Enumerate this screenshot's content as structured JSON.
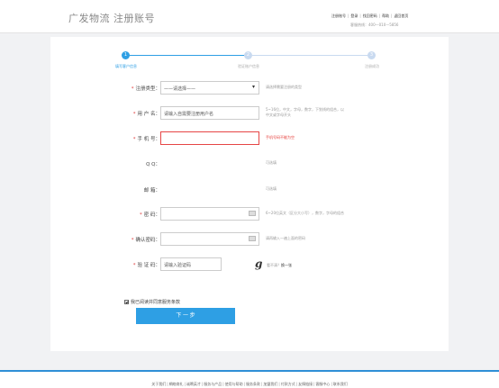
{
  "header": {
    "logo": "广发物流 注册账号",
    "links": [
      "注册账号",
      "登录",
      "找回密码",
      "帮助",
      "返回首页"
    ],
    "hotline": "客服热线：400—010—5856"
  },
  "steps": [
    {
      "num": "1",
      "label": "填写客户信息",
      "active": true
    },
    {
      "num": "2",
      "label": "验证账户信息",
      "active": false
    },
    {
      "num": "3",
      "label": "注册成功",
      "active": false
    }
  ],
  "form": {
    "type": {
      "label": "注册类型：",
      "value": "——请选择——",
      "hint": "请选择需要注册的类型"
    },
    "username": {
      "label": "用 户 名：",
      "placeholder": "请输入自需要注册用户名",
      "hint1": "5~16位，中文，字母，数字，下划线的组合，以",
      "hint2": "中文或字母开头"
    },
    "phone": {
      "label": "手 机 号：",
      "value": "",
      "hint": "手机号码不能为空"
    },
    "qq": {
      "label": "Q      Q：",
      "hint": "可选填"
    },
    "email": {
      "label": "邮      箱：",
      "hint": "可选填"
    },
    "password": {
      "label": "密      码：",
      "hint": "6~20位英文（区分大小写），数字，字母的组合"
    },
    "confirm": {
      "label": "确认密码：",
      "hint": "请再输入一遍上面的密码"
    },
    "captcha": {
      "label": "验 证 码：",
      "placeholder": "请输入验证码",
      "char": "g",
      "hint_prefix": "看不清？",
      "hint_link": "换一张"
    }
  },
  "agree_text": "我已阅读并同意服务条款",
  "next_button": "下 一 步",
  "footer": [
    "关于我们",
    "網絡商礼",
    "诚聘英才",
    "服务与产品",
    "使用与帮助",
    "服务条款",
    "加盟我们",
    "付款方式",
    "友情链接",
    "客服中心",
    "联系我们"
  ],
  "colors": {
    "accent": "#2e9fe4",
    "error": "#e53935",
    "inactive_step": "#c9daf0"
  }
}
